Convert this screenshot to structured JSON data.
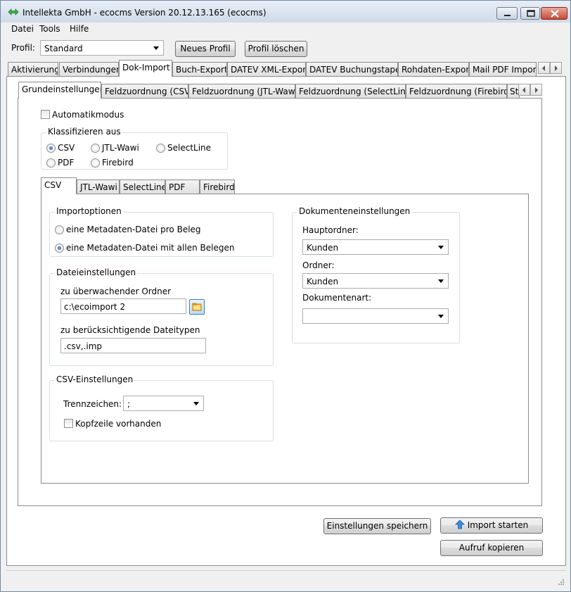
{
  "window": {
    "title": "Intellekta GmbH - ecocms Version 20.12.13.165 (ecocms)"
  },
  "menu": {
    "datei": "Datei",
    "tools": "Tools",
    "hilfe": "Hilfe"
  },
  "profile": {
    "label": "Profil:",
    "selected": "Standard",
    "new_button": "Neues Profil",
    "delete_button": "Profil löschen"
  },
  "main_tabs": [
    {
      "label": "Aktivierung"
    },
    {
      "label": "Verbindungen"
    },
    {
      "label": "Dok-Import"
    },
    {
      "label": "Buch-Export"
    },
    {
      "label": "DATEV XML-Export"
    },
    {
      "label": "DATEV Buchungstapel"
    },
    {
      "label": "Rohdaten-Export"
    },
    {
      "label": "Mail PDF Import"
    }
  ],
  "sub_tabs": [
    {
      "label": "Grundeinstellungen"
    },
    {
      "label": "Feldzuordnung (CSV)"
    },
    {
      "label": "Feldzuordnung (JTL-Wawi)"
    },
    {
      "label": "Feldzuordnung (SelectLine)"
    },
    {
      "label": "Feldzuordnung (Firebird)"
    },
    {
      "label": "St"
    }
  ],
  "automatikmodus": {
    "label": "Automatikmodus",
    "checked": false
  },
  "klassifizieren": {
    "title": "Klassifizieren aus",
    "options": [
      {
        "label": "CSV",
        "checked": true
      },
      {
        "label": "JTL-Wawi",
        "checked": false
      },
      {
        "label": "SelectLine",
        "checked": false
      },
      {
        "label": "PDF",
        "checked": false
      },
      {
        "label": "Firebird",
        "checked": false
      }
    ]
  },
  "source_tabs": [
    {
      "label": "CSV"
    },
    {
      "label": "JTL-Wawi"
    },
    {
      "label": "SelectLine"
    },
    {
      "label": "PDF"
    },
    {
      "label": "Firebird"
    }
  ],
  "importoptionen": {
    "title": "Importoptionen",
    "options": [
      {
        "label": "eine Metadaten-Datei pro Beleg",
        "checked": false
      },
      {
        "label": "eine Metadaten-Datei mit allen Belegen",
        "checked": true
      }
    ]
  },
  "dateieinstellungen": {
    "title": "Dateieinstellungen",
    "folder_label": "zu überwachender Ordner",
    "folder_value": "c:\\ecoimport 2",
    "types_label": "zu berücksichtigende Dateitypen",
    "types_value": ".csv,.imp"
  },
  "csv_einstellungen": {
    "title": "CSV-Einstellungen",
    "separator_label": "Trennzeichen:",
    "separator_value": ";",
    "header_label": "Kopfzeile vorhanden",
    "header_checked": false
  },
  "dokumenteneinstellungen": {
    "title": "Dokumenteneinstellungen",
    "hauptordner_label": "Hauptordner:",
    "hauptordner_value": "Kunden",
    "ordner_label": "Ordner:",
    "ordner_value": "Kunden",
    "dokumentenart_label": "Dokumentenart:",
    "dokumentenart_value": ""
  },
  "buttons": {
    "save": "Einstellungen speichern",
    "import": "Import starten",
    "copy": "Aufruf kopieren"
  },
  "icons": {
    "app": "arrows-icon",
    "folder": "folder-icon",
    "import": "up-arrow-icon"
  }
}
